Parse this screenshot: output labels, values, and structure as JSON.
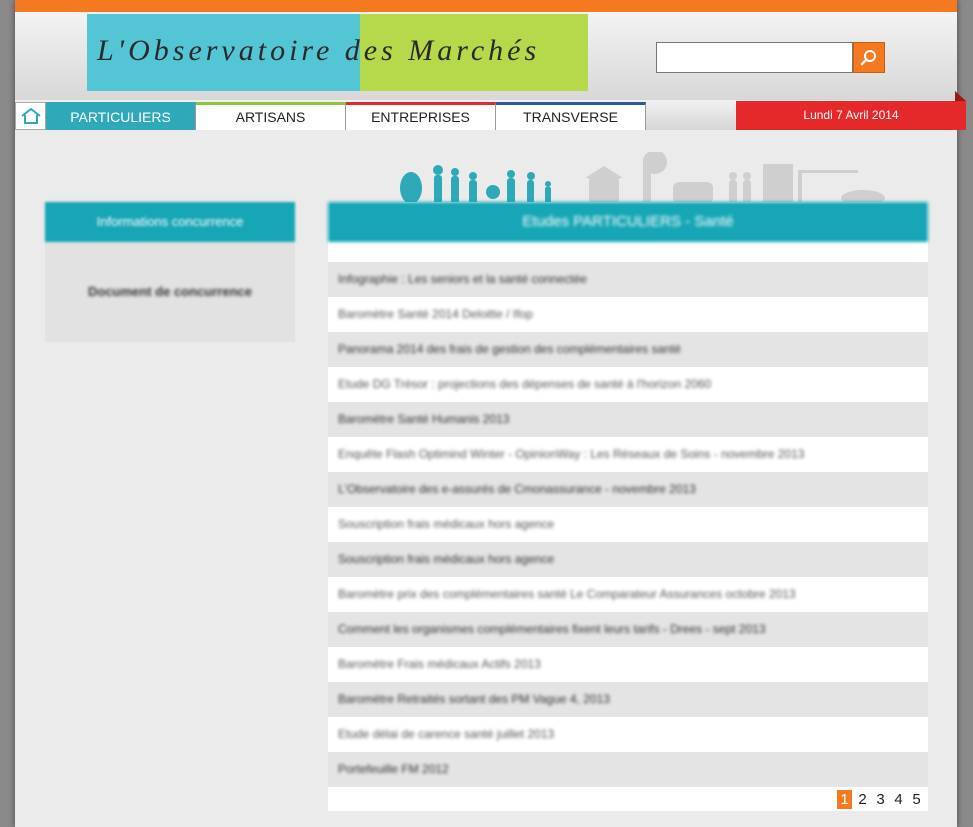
{
  "colors": {
    "orange": "#f47920",
    "teal": "#16a6b6",
    "logo_blue": "#53c5d4",
    "logo_green": "#b5d94a",
    "date_red": "#e5292b"
  },
  "header": {
    "logo_text": "L'Observatoire des Marchés",
    "search": {
      "value": "",
      "placeholder": ""
    },
    "search_icon": "magnifier-icon"
  },
  "nav": {
    "home_icon": "home-icon",
    "items": [
      {
        "label": "PARTICULIERS",
        "accent": "#2fa8b8"
      },
      {
        "label": "ARTISANS",
        "accent": "#8dc63f"
      },
      {
        "label": "ENTREPRISES",
        "accent": "#e5292b"
      },
      {
        "label": "TRANSVERSE",
        "accent": "#2a5a9a"
      }
    ],
    "date": "Lundi 7 Avril 2014"
  },
  "sidebar": {
    "title": "Informations concurrence",
    "link": "Document de concurrence"
  },
  "main": {
    "title": "Etudes PARTICULIERS - Santé",
    "items": [
      "Infographie : Les seniors et la santé connectée",
      "Baromètre Santé 2014 Deloitte / Ifop",
      "Panorama 2014 des frais de gestion des complémentaires santé",
      "Etude DG Trésor : projections des dépenses de santé à l'horizon 2060",
      "Baromètre Santé Humanis 2013",
      "Enquête Flash Optimind Winter - OpinionWay : Les Réseaux de Soins - novembre 2013",
      "L'Observatoire des e-assurés de Cmonassurance - novembre 2013",
      "Souscription frais médicaux hors agence",
      "Souscription frais médicaux hors agence",
      "Baromètre prix des complémentaires santé Le Comparateur Assurances octobre 2013",
      "Comment les organismes complémentaires fixent leurs tarifs - Drees - sept 2013",
      "Baromètre Frais médicaux Actifs 2013",
      "Baromètre Retraités sortant des PM Vague 4, 2013",
      "Etude délai de carence santé juillet 2013",
      "Portefeuille FM 2012"
    ],
    "pages": [
      "1",
      "2",
      "3",
      "4",
      "5"
    ],
    "current_page": "1"
  }
}
